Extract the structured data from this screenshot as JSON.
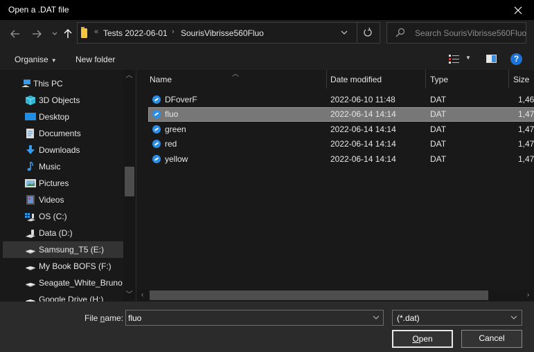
{
  "window": {
    "title": "Open a .DAT file",
    "close_icon": "close-icon"
  },
  "nav": {
    "back_icon": "back-arrow-icon",
    "forward_icon": "forward-arrow-icon",
    "recent_icon": "chevron-down-icon",
    "up_icon": "up-arrow-icon",
    "breadcrumb": {
      "overflow": "«",
      "items": [
        "Tests 2022-06-01",
        "SourisVibrisse560Fluo"
      ],
      "separator": "›"
    },
    "search_placeholder": "Search SourisVibrisse560Fluo"
  },
  "toolbar": {
    "organise_label": "Organise",
    "new_folder_label": "New folder",
    "help_label": "?"
  },
  "sidebar": {
    "items": [
      {
        "label": "This PC",
        "icon": "computer-icon"
      },
      {
        "label": "3D Objects",
        "icon": "cube-icon"
      },
      {
        "label": "Desktop",
        "icon": "desktop-icon"
      },
      {
        "label": "Documents",
        "icon": "document-icon"
      },
      {
        "label": "Downloads",
        "icon": "download-icon"
      },
      {
        "label": "Music",
        "icon": "music-icon"
      },
      {
        "label": "Pictures",
        "icon": "picture-icon"
      },
      {
        "label": "Videos",
        "icon": "video-icon"
      },
      {
        "label": "OS (C:)",
        "icon": "windows-drive-icon"
      },
      {
        "label": "Data (D:)",
        "icon": "drive-icon"
      },
      {
        "label": "Samsung_T5 (E:)",
        "icon": "usb-drive-icon",
        "selected": true
      },
      {
        "label": "My Book BOFS (F:)",
        "icon": "usb-drive-icon"
      },
      {
        "label": "Seagate_White_Bruno (",
        "icon": "usb-drive-icon"
      },
      {
        "label": "Google Drive (H:)",
        "icon": "usb-drive-icon"
      }
    ]
  },
  "filelist": {
    "columns": [
      "Name",
      "Date modified",
      "Type",
      "Size"
    ],
    "rows": [
      {
        "name": "DFoverF",
        "date": "2022-06-10 11:48",
        "type": "DAT",
        "size": "1,46"
      },
      {
        "name": "fluo",
        "date": "2022-06-14 14:14",
        "type": "DAT",
        "size": "1,47",
        "selected": true
      },
      {
        "name": "green",
        "date": "2022-06-14 14:14",
        "type": "DAT",
        "size": "1,47"
      },
      {
        "name": "red",
        "date": "2022-06-14 14:14",
        "type": "DAT",
        "size": "1,47"
      },
      {
        "name": "yellow",
        "date": "2022-06-14 14:14",
        "type": "DAT",
        "size": "1,47"
      }
    ]
  },
  "bottom": {
    "file_name_label_pre": "File ",
    "file_name_label_u": "n",
    "file_name_label_post": "ame:",
    "file_name_value": "fluo",
    "filter_value": "(*.dat)",
    "open_u": "O",
    "open_rest": "pen",
    "cancel_label": "Cancel"
  },
  "colors": {
    "accent": "#2a8ee6",
    "help": "#1a73d8",
    "folder": "#f5c640"
  }
}
